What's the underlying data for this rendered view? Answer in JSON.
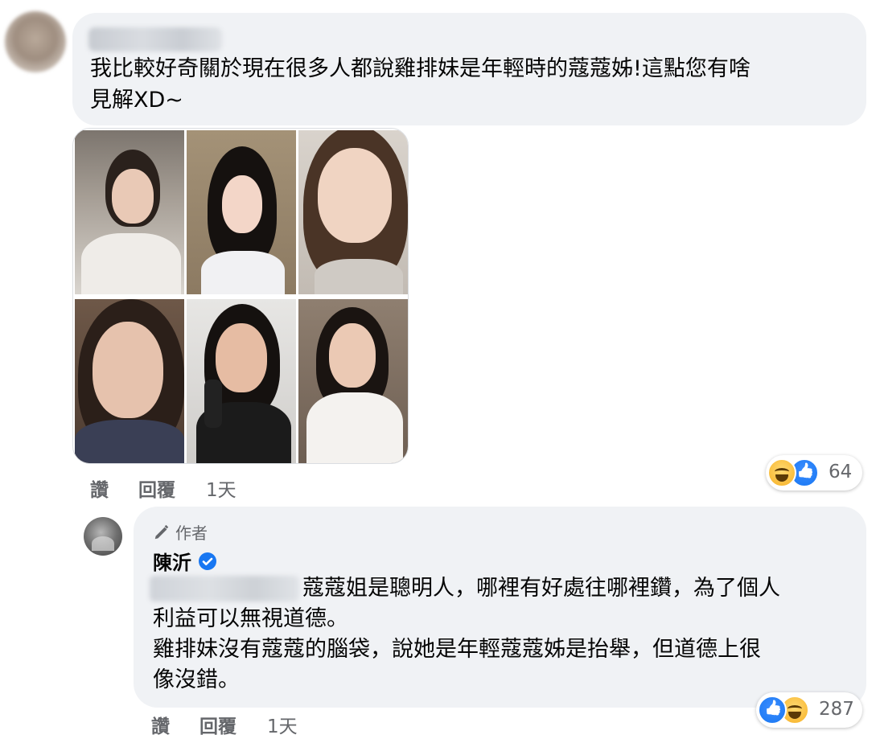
{
  "comment1": {
    "author_redacted": true,
    "text": "我比較好奇關於現在很多人都說雞排妹是年輕時的蔻蔻姊!這點您有啥見解XD~",
    "text_line1": "我比較好奇關於現在很多人都說雞排妹是年輕時的蔻蔻姊!這點您有啥",
    "text_line2": "見解XD~",
    "image_icon": "photo-collage-6",
    "actions": {
      "like": "讚",
      "reply": "回覆",
      "time": "1天"
    },
    "reactions": {
      "icons": [
        "haha-icon",
        "like-icon"
      ],
      "count": "64"
    }
  },
  "comment2": {
    "badge": "作者",
    "badge_icon": "pencil-icon",
    "author": "陳沂",
    "verified_icon": "verified-check-icon",
    "mention_redacted": true,
    "line1": "蔻蔻姐是聰明人，哪裡有好處往哪裡鑽，為了個人",
    "line2": "利益可以無視道德。",
    "line3": "雞排妹沒有蔻蔻的腦袋，說她是年輕蔻蔻姊是抬舉，但道德上很",
    "line4": "像沒錯。",
    "actions": {
      "like": "讚",
      "reply": "回覆",
      "time": "1天"
    },
    "reactions": {
      "icons": [
        "like-icon",
        "haha-icon"
      ],
      "count": "287"
    }
  },
  "colors": {
    "bubble": "#f0f2f5",
    "secondary_text": "#65676b",
    "facebook_blue": "#1877f2"
  }
}
